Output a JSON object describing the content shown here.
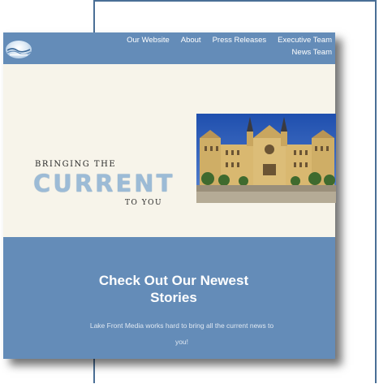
{
  "nav": {
    "items": [
      {
        "label": "Our Website"
      },
      {
        "label": "About"
      },
      {
        "label": "Press Releases"
      },
      {
        "label": "Executive Team"
      },
      {
        "label": "News Team"
      }
    ]
  },
  "hero": {
    "tagline_top": "BRINGING THE",
    "tagline_main": "CURRENT",
    "tagline_bottom": "TO YOU"
  },
  "stories": {
    "title": "Check Out Our Newest Stories",
    "description": "Lake Front Media works hard to bring all the current news to you!"
  },
  "colors": {
    "header_bg": "#648cb8",
    "hero_bg": "#f7f4ea",
    "frame_line": "#4a6f96"
  }
}
